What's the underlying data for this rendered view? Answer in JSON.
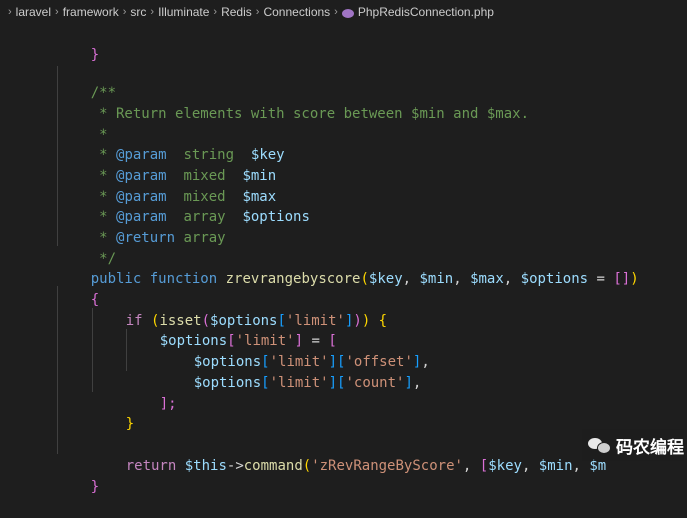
{
  "breadcrumb": {
    "items": [
      "laravel",
      "framework",
      "src",
      "Illuminate",
      "Redis",
      "Connections",
      "PhpRedisConnection.php"
    ]
  },
  "code": {
    "line_close_prev": "}",
    "doc_open": "/**",
    "doc_desc": " * Return elements with score between $min and $max.",
    "doc_blank": " *",
    "param1": {
      "star": " * ",
      "tag": "@param",
      "type": "  string  ",
      "var": "$key"
    },
    "param2": {
      "star": " * ",
      "tag": "@param",
      "type": "  mixed  ",
      "var": "$min"
    },
    "param3": {
      "star": " * ",
      "tag": "@param",
      "type": "  mixed  ",
      "var": "$max"
    },
    "param4": {
      "star": " * ",
      "tag": "@param",
      "type": "  array  ",
      "var": "$options"
    },
    "ret": {
      "star": " * ",
      "tag": "@return",
      "type": " array"
    },
    "doc_close": " */",
    "sig": {
      "public": "public",
      "function": "function",
      "name": "zrevrangebyscore",
      "open": "(",
      "p_key": "$key",
      "comma1": ", ",
      "p_min": "$min",
      "comma2": ", ",
      "p_max": "$max",
      "comma3": ", ",
      "p_options": "$options",
      "eq": " = ",
      "arr": "[]",
      "close": ")"
    },
    "brace_open": "{",
    "if_line": {
      "kw": "if",
      "sp": " ",
      "p1": "(",
      "isset": "isset",
      "p2": "(",
      "var": "$options",
      "b1": "[",
      "str": "'limit'",
      "b2": "]",
      "p3": ")",
      "p4": ")",
      "brace": " {"
    },
    "assign_line": {
      "var": "$options",
      "b1": "[",
      "str": "'limit'",
      "b2": "]",
      "eq": " = ",
      "open": "["
    },
    "offset_line": {
      "var": "$options",
      "b1": "[",
      "s1": "'limit'",
      "b2": "][",
      "s2": "'offset'",
      "b3": "]",
      "comma": ","
    },
    "count_line": {
      "var": "$options",
      "b1": "[",
      "s1": "'limit'",
      "b2": "][",
      "s2": "'count'",
      "b3": "]",
      "comma": ","
    },
    "arr_close": "];",
    "if_close": "}",
    "return_line": {
      "kw": "return",
      "sp": " ",
      "this": "$this",
      "arrow": "->",
      "fn": "command",
      "p1": "(",
      "str": "'zRevRangeByScore'",
      "comma": ", ",
      "b1": "[",
      "key": "$key",
      "c1": ", ",
      "min": "$min",
      "c2": ", ",
      "max": "$m"
    },
    "brace_close": "}"
  },
  "watermark": {
    "text": "码农编程",
    "icon": "wechat-icon"
  },
  "colors": {
    "background": "#1e1e1e",
    "comment": "#6a9955",
    "keyword": "#569cd6",
    "control": "#c586c0",
    "function": "#dcdcaa",
    "variable": "#9cdcfe",
    "string": "#ce9178"
  }
}
